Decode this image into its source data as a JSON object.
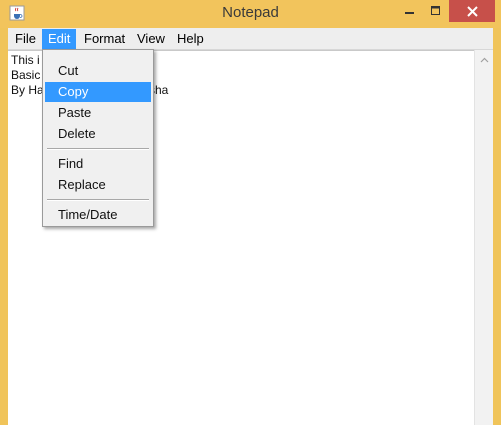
{
  "window": {
    "title": "Notepad",
    "icon": "java-cup-icon",
    "close_color": "#c7504a",
    "frame_color": "#f2c45c"
  },
  "menubar": {
    "items": [
      {
        "label": "File"
      },
      {
        "label": "Edit",
        "active": true
      },
      {
        "label": "Format"
      },
      {
        "label": "View"
      },
      {
        "label": "Help"
      }
    ],
    "highlight_color": "#3399ff"
  },
  "editor": {
    "lines": [
      {
        "left": "This i",
        "right": ""
      },
      {
        "left": "Basic",
        "right": ""
      },
      {
        "left": "By Ha",
        "right": "sha"
      }
    ]
  },
  "edit_menu": {
    "items": [
      {
        "label": "Cut"
      },
      {
        "label": "Copy",
        "selected": true
      },
      {
        "label": "Paste"
      },
      {
        "label": "Delete"
      },
      {
        "label": "Find"
      },
      {
        "label": "Replace"
      },
      {
        "label": "Time/Date"
      }
    ]
  }
}
